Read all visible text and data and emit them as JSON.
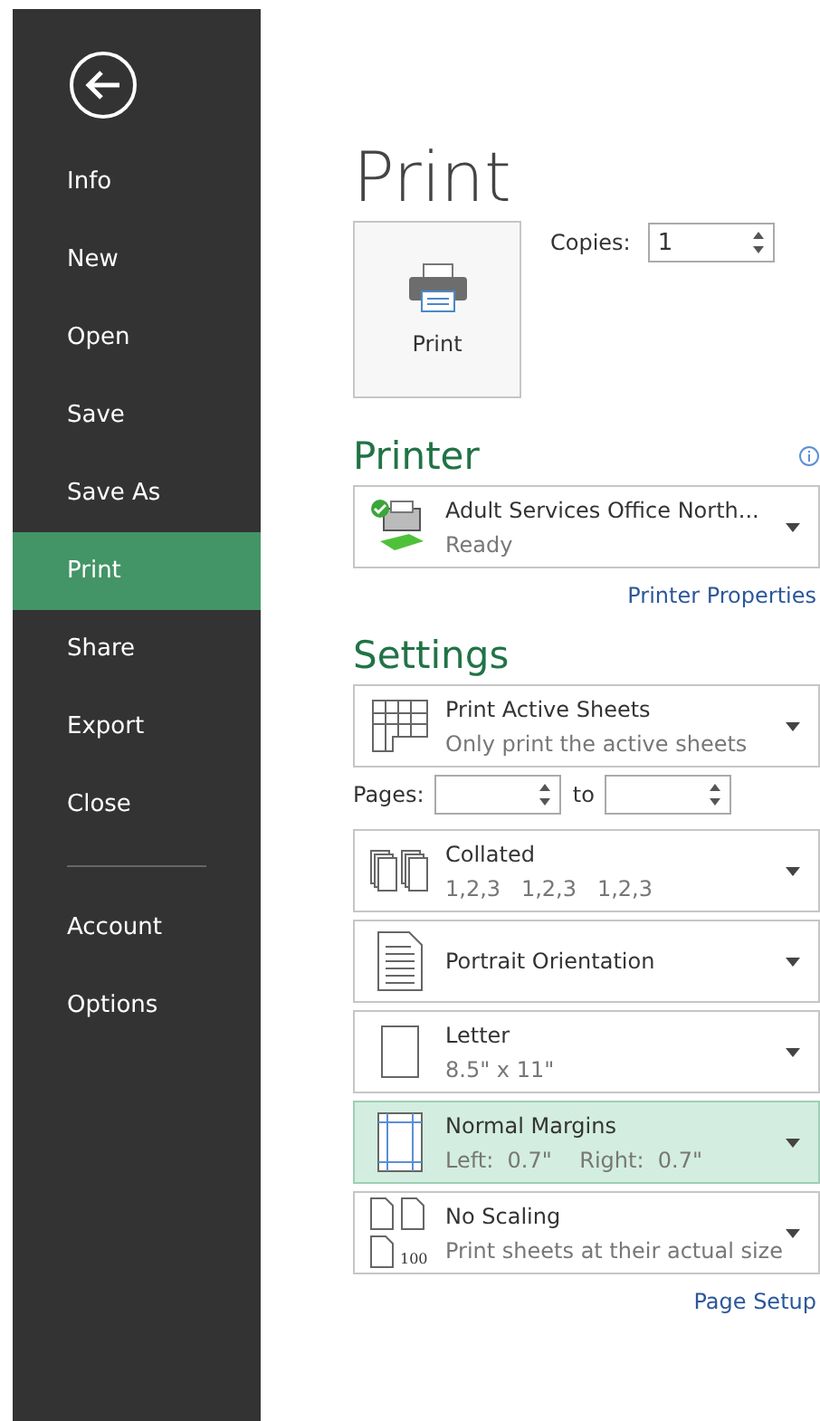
{
  "sidebar": {
    "items": [
      {
        "label": "Info",
        "selected": false
      },
      {
        "label": "New",
        "selected": false
      },
      {
        "label": "Open",
        "selected": false
      },
      {
        "label": "Save",
        "selected": false
      },
      {
        "label": "Save As",
        "selected": false
      },
      {
        "label": "Print",
        "selected": true
      },
      {
        "label": "Share",
        "selected": false
      },
      {
        "label": "Export",
        "selected": false
      },
      {
        "label": "Close",
        "selected": false
      },
      {
        "label": "Account",
        "selected": false
      },
      {
        "label": "Options",
        "selected": false
      }
    ]
  },
  "title": "Print",
  "print_button": {
    "label": "Print"
  },
  "copies": {
    "label": "Copies:",
    "value": "1"
  },
  "printer": {
    "heading": "Printer",
    "name": "Adult Services Office North...",
    "status": "Ready",
    "link": "Printer Properties"
  },
  "settings": {
    "heading": "Settings",
    "items": [
      {
        "kind": "sheets",
        "title": "Print Active Sheets",
        "subtitle": "Only print the active sheets",
        "highlighted": false
      },
      {
        "kind": "pages",
        "label": "Pages:",
        "to": "to"
      },
      {
        "kind": "collated",
        "title": "Collated",
        "subtitle": "1,2,3   1,2,3   1,2,3",
        "highlighted": false
      },
      {
        "kind": "orientation",
        "title": "Portrait Orientation",
        "highlighted": false
      },
      {
        "kind": "paper",
        "title": "Letter",
        "subtitle": "8.5\" x 11\"",
        "highlighted": false
      },
      {
        "kind": "margins",
        "title": "Normal Margins",
        "subtitle": "Left:  0.7\"    Right:  0.7\"",
        "highlighted": true
      },
      {
        "kind": "scaling",
        "title": "No Scaling",
        "subtitle": "Print sheets at their actual size",
        "icon_label": "100",
        "highlighted": false
      }
    ],
    "link": "Page Setup"
  }
}
